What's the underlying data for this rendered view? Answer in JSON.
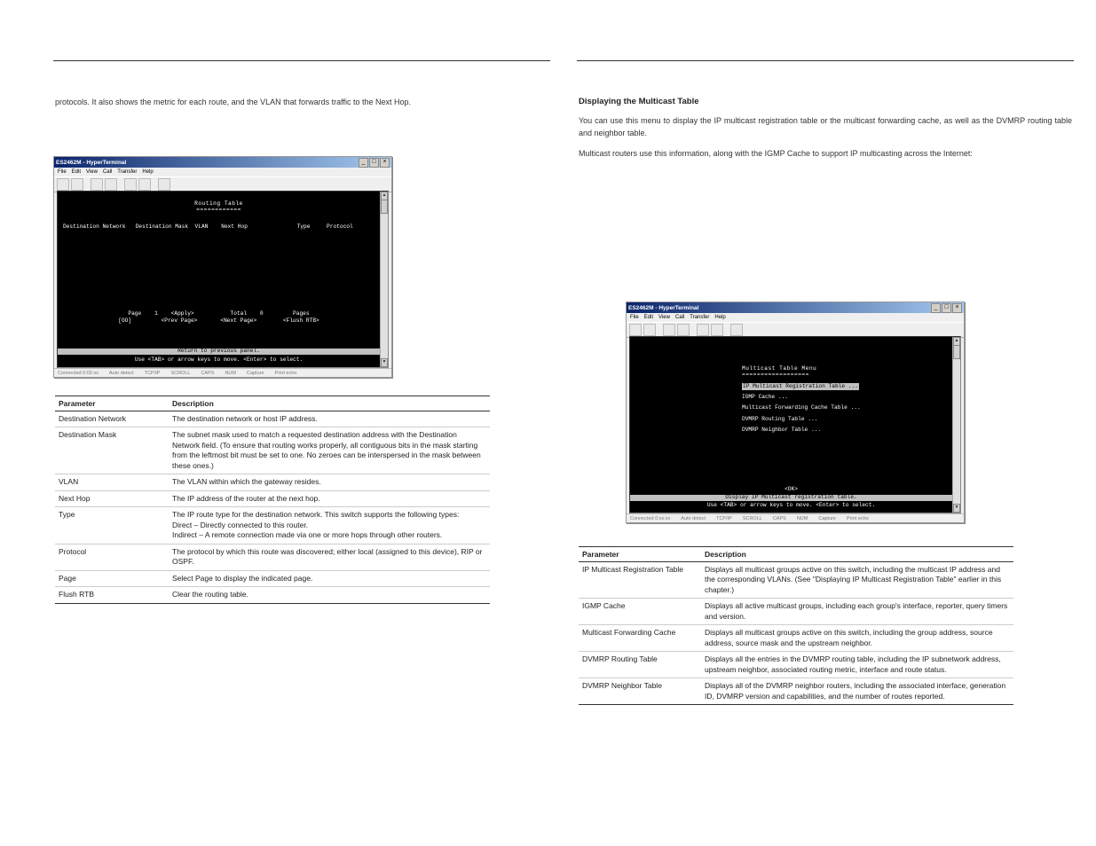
{
  "left": {
    "header_title": "",
    "intro1": "protocols. It also shows the metric for each route, and the VLAN that forwards traffic to the Next Hop.",
    "screenshot": {
      "app_title": "ES2462M - HyperTerminal",
      "menu": [
        "File",
        "Edit",
        "View",
        "Call",
        "Transfer",
        "Help"
      ],
      "terminal": {
        "title": "Routing Table",
        "columns_line": "Destination Network   Destination Mask  VLAN    Next Hop               Type     Protocol",
        "page_line1": "Page    1    <Apply>           Total    0         Pages",
        "page_line2": "[GO]         <Prev Page>       <Next Page>        <Flush RTB>",
        "return_line": "Return to previous panel.",
        "hint_line": "Use <TAB> or arrow keys to move. <Enter> to select."
      },
      "status": [
        "Connected 0:02:xx",
        "Auto detect",
        "TCP/IP",
        "",
        "",
        "SCROLL",
        "",
        "CAPS",
        "NUM",
        "Capture",
        "Print echo"
      ]
    },
    "table": [
      {
        "p": "Destination Network",
        "d": "The destination network or host IP address."
      },
      {
        "p": "Destination Mask",
        "d": "The subnet mask used to match a requested destination address with the Destination Network field. (To ensure that routing works properly, all contiguous bits in the mask starting from the leftmost bit must be set to one. No zeroes can be interspersed in the mask between these ones.)"
      },
      {
        "p": "VLAN",
        "d": "The VLAN within which the gateway resides."
      },
      {
        "p": "Next Hop",
        "d": "The IP address of the router at the next hop."
      },
      {
        "p": "Type",
        "d": "The IP route type for the destination network. This switch supports the following types:\nDirect – Directly connected to this router.\nIndirect – A remote connection made via one or more hops through other routers."
      },
      {
        "p": "Protocol",
        "d": "The protocol by which this route was discovered; either local (assigned to this device), RIP or OSPF."
      },
      {
        "p": "Page",
        "d": "Select Page to display the indicated page."
      },
      {
        "p": "Flush RTB",
        "d": "Clear the routing table."
      }
    ],
    "pagenum": ""
  },
  "right": {
    "header_title": "",
    "section_title": "Displaying the Multicast Table",
    "intro1": "You can use this menu to display the IP multicast registration table or the multicast forwarding cache, as well as the DVMRP routing table and neighbor table.",
    "intro2": "Multicast routers use this information, along with the IGMP Cache to support IP multicasting across the Internet:",
    "screenshot": {
      "app_title": "ES2462M - HyperTerminal",
      "menu": [
        "File",
        "Edit",
        "View",
        "Call",
        "Transfer",
        "Help"
      ],
      "terminal": {
        "title": "Multicast Table Menu",
        "items": [
          "IP Multicast Registration Table ...",
          "IGMP Cache ...",
          "Multicast Forwarding Cache Table ...",
          "DVMRP Routing Table ...",
          "DVMRP Neighbor Table ..."
        ],
        "ok": "<OK>",
        "display_line": "Display IP Multicast registration table.",
        "hint_line": "Use <TAB> or arrow keys to move. <Enter> to select."
      },
      "status": [
        "Connected 0:xx:xx",
        "Auto detect",
        "TCP/IP",
        "",
        "",
        "SCROLL",
        "",
        "CAPS",
        "NUM",
        "Capture",
        "Print echo"
      ]
    },
    "table": [
      {
        "p": "IP Multicast Registration Table",
        "d": "Displays all multicast groups active on this switch, including the multicast IP address and the corresponding VLANs. (See \"Displaying IP Multicast Registration Table\" earlier in this chapter.)"
      },
      {
        "p": "IGMP Cache",
        "d": "Displays all active multicast groups, including each group's interface, reporter, query timers and version."
      },
      {
        "p": "Multicast Forwarding Cache",
        "d": "Displays all multicast groups active on this switch, including the group address, source address, source mask and the upstream neighbor."
      },
      {
        "p": "DVMRP Routing Table",
        "d": "Displays all the entries in the DVMRP routing table, including the IP subnetwork address, upstream neighbor, associated routing metric, interface and route status."
      },
      {
        "p": "DVMRP Neighbor Table",
        "d": "Displays all of the DVMRP neighbor routers, including the associated interface, generation ID, DVMRP version and capabilities, and the number of routes reported."
      }
    ],
    "pagenum": ""
  }
}
